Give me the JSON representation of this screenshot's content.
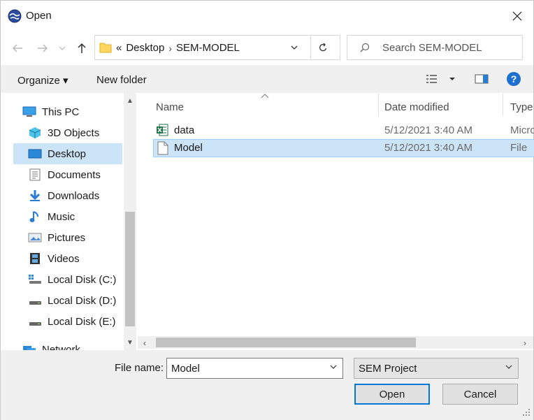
{
  "window": {
    "title": "Open"
  },
  "address": {
    "overflow": "«",
    "crumbs": [
      "Desktop",
      "SEM-MODEL"
    ]
  },
  "search": {
    "placeholder": "Search SEM-MODEL"
  },
  "commands": {
    "organize": "Organize ▾",
    "new_folder": "New folder"
  },
  "nav": {
    "items": [
      {
        "label": "This PC",
        "icon": "pc-icon"
      },
      {
        "label": "3D Objects",
        "icon": "cube-icon"
      },
      {
        "label": "Desktop",
        "icon": "desktop-icon"
      },
      {
        "label": "Documents",
        "icon": "documents-icon"
      },
      {
        "label": "Downloads",
        "icon": "download-arrow-icon"
      },
      {
        "label": "Music",
        "icon": "music-note-icon"
      },
      {
        "label": "Pictures",
        "icon": "pictures-icon"
      },
      {
        "label": "Videos",
        "icon": "film-icon"
      },
      {
        "label": "Local Disk (C:)",
        "icon": "windows-drive-icon"
      },
      {
        "label": "Local Disk (D:)",
        "icon": "drive-icon"
      },
      {
        "label": "Local Disk (E:)",
        "icon": "drive-icon"
      },
      {
        "label": "Network",
        "icon": "network-icon"
      }
    ],
    "selected": "Desktop"
  },
  "columns": {
    "name": "Name",
    "date": "Date modified",
    "type": "Type"
  },
  "files": [
    {
      "name": "data",
      "date": "5/12/2021 3:40 AM",
      "type": "Micro",
      "icon": "excel-icon"
    },
    {
      "name": "Model",
      "date": "5/12/2021 3:40 AM",
      "type": "File",
      "icon": "blank-file-icon"
    }
  ],
  "footer": {
    "file_name_label": "File name:",
    "file_name_value": "Model",
    "file_type": "SEM Project",
    "open": "Open",
    "cancel": "Cancel"
  },
  "colors": {
    "selection": "#cce4f7",
    "accent": "#0078d7"
  }
}
